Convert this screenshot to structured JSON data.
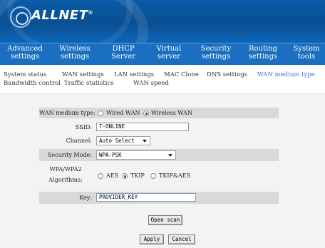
{
  "brand": {
    "name": "ALLNET",
    "trademark": "®"
  },
  "nav": [
    {
      "line1": "Advanced",
      "line2": "settings"
    },
    {
      "line1": "Wireless",
      "line2": "settings"
    },
    {
      "line1": "DHCP",
      "line2": "Server"
    },
    {
      "line1": "Virtual",
      "line2": "server"
    },
    {
      "line1": "Security",
      "line2": "settings"
    },
    {
      "line1": "Routing",
      "line2": "settings"
    },
    {
      "line1": "System",
      "line2": "tools"
    }
  ],
  "subnav": [
    "System status",
    "WAN settings",
    "LAN settings",
    "MAC Clone",
    "DNS settings",
    "WAN medium type",
    "Bandwidth control",
    "Traffic statistics",
    "WAN speed"
  ],
  "form": {
    "wan_medium_label": "WAN medium type:",
    "wan_options": [
      "Wired WAN",
      "Wireless WAN"
    ],
    "wan_selected": "Wireless WAN",
    "ssid_label": "SSID:",
    "ssid_value": "T-ONLINE",
    "channel_label": "Channel:",
    "channel_value": "Auto Select",
    "security_label": "Security Mode:",
    "security_value": "WPA-PSK",
    "algo_label_1": "WPA/WPA2",
    "algo_label_2": "Algorithms:",
    "algo_options": [
      "AES",
      "TKIP",
      "TKIP&AES"
    ],
    "algo_selected": "TKIP",
    "key_label": "Key:",
    "key_value": "PROVIDER_KEY"
  },
  "buttons": {
    "open_scan": "Open scan",
    "apply": "Apply",
    "cancel": "Cancel"
  },
  "colors": {
    "header": "#0b5ca8",
    "nav": "#1b6fc0",
    "active_subnav": "#4a6fd6"
  }
}
